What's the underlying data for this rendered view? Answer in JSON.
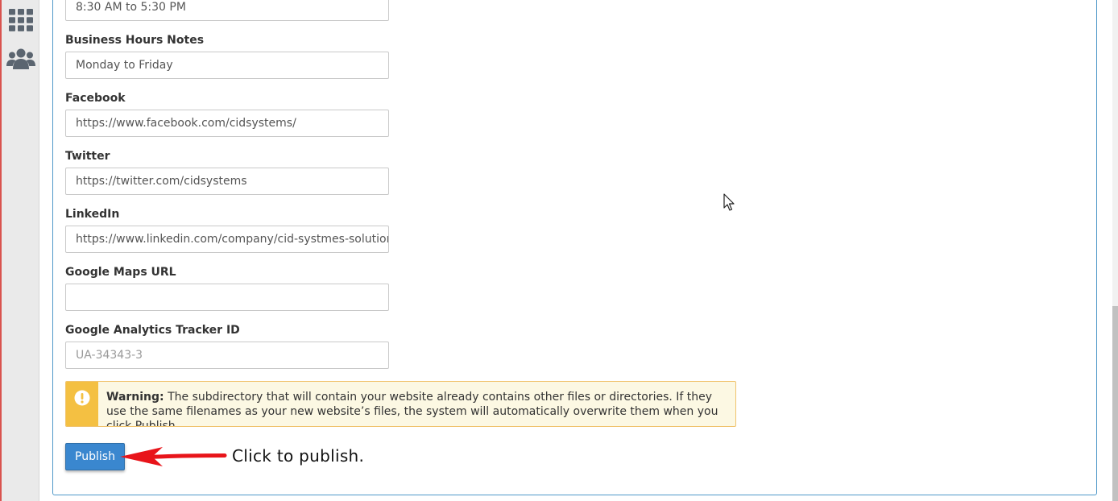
{
  "sidebar": {
    "icons": [
      {
        "name": "apps-grid-icon"
      },
      {
        "name": "users-icon"
      }
    ]
  },
  "form": {
    "business_hours": {
      "value": "8:30 AM to 5:30 PM"
    },
    "business_hours_notes": {
      "label": "Business Hours Notes",
      "value": "Monday to Friday"
    },
    "facebook": {
      "label": "Facebook",
      "value": "https://www.facebook.com/cidsystems/"
    },
    "twitter": {
      "label": "Twitter",
      "value": "https://twitter.com/cidsystems"
    },
    "linkedin": {
      "label": "LinkedIn",
      "value": "https://www.linkedin.com/company/cid-systmes-solution-"
    },
    "google_maps": {
      "label": "Google Maps URL",
      "value": ""
    },
    "google_analytics": {
      "label": "Google Analytics Tracker ID",
      "placeholder": "UA-34343-3"
    }
  },
  "warning": {
    "title": "Warning:",
    "message": "The subdirectory that will contain your website already contains other files or directories. If they use the same filenames as your new website’s files, the system will automatically overwrite them when you click Publish."
  },
  "publish_button": {
    "label": "Publish"
  },
  "annotation": {
    "text": "Click to publish."
  },
  "colors": {
    "accent": "#3a87cf",
    "warning_strip": "#f4c042",
    "warning_bg": "#fcf8e3",
    "annotation_arrow": "#e8141a"
  }
}
